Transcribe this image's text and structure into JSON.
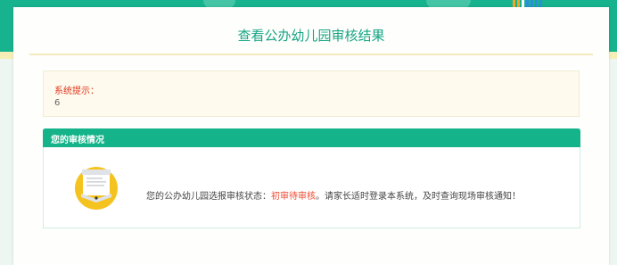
{
  "page": {
    "title": "查看公办幼儿园审核结果"
  },
  "notice": {
    "label": "系统提示：",
    "value": "6"
  },
  "review": {
    "header": "您的审核情况",
    "status_prefix": "您的公办幼儿园选报审核状态：",
    "status_value": "初审待审核",
    "status_suffix": "。请家长适时登录本系统，及时查询现场审核通知！",
    "status_icon": "document-icon"
  },
  "colors": {
    "brand_green": "#17b38e",
    "title_green": "#17a584",
    "alert_red": "#e0361d",
    "status_red": "#f04a31",
    "icon_yellow": "#f5c31f"
  }
}
